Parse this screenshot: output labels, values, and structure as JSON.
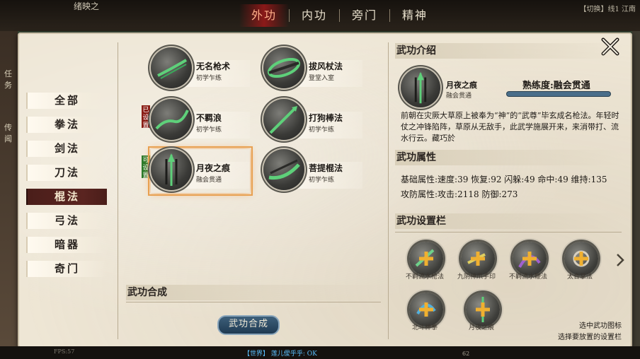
{
  "topbar": {
    "player_name": "绪映之",
    "tabs": [
      {
        "label": "外功",
        "active": true
      },
      {
        "label": "内功",
        "active": false
      },
      {
        "label": "旁门",
        "active": false
      },
      {
        "label": "精神",
        "active": false
      }
    ],
    "right_info": "【切换】线1   江南"
  },
  "left_side_text": [
    "任务",
    "传闻"
  ],
  "categories": [
    {
      "label": "全部",
      "active": false
    },
    {
      "label": "拳法",
      "active": false
    },
    {
      "label": "剑法",
      "active": false
    },
    {
      "label": "刀法",
      "active": false
    },
    {
      "label": "棍法",
      "active": true
    },
    {
      "label": "弓法",
      "active": false
    },
    {
      "label": "暗器",
      "active": false
    },
    {
      "label": "奇门",
      "active": false
    }
  ],
  "skills": [
    {
      "name": "无名枪术",
      "level": "初学乍练",
      "icon": "spear-green-icon",
      "tag": ""
    },
    {
      "name": "拔风杖法",
      "level": "登堂入室",
      "icon": "staff-wrap-icon",
      "tag": ""
    },
    {
      "name": "不羁浪",
      "level": "初学乍练",
      "icon": "spear-wave-icon",
      "tag": "已设置"
    },
    {
      "name": "打狗棒法",
      "level": "初学乍练",
      "icon": "stick-icon",
      "tag": ""
    },
    {
      "name": "月夜之痕",
      "level": "融会贯通",
      "icon": "spear-icon",
      "tag": "可设置"
    },
    {
      "name": "菩提棍法",
      "level": "初学乍练",
      "icon": "staff-curve-icon",
      "tag": ""
    }
  ],
  "synthesis": {
    "heading": "武功合成",
    "button_label": "武功合成"
  },
  "info": {
    "heading": "武功介绍",
    "skill_name": "月夜之痕",
    "skill_level": "融会贯通",
    "proficiency": "熟练度:融会贯通",
    "proficiency_progress": 1.0,
    "description": "前朝在灾厥大草原上被奉为“神”的“武尊”毕玄成名枪法。年轻时仗之冲锋陷阵，草原从无敌手，此武学施展开来，来消带打、流水行云。藏巧於",
    "attr_heading": "武功属性",
    "attr_line1": "基础属性:速度:39 恢复:92 闪躲:49 命中:49 维持:135",
    "attr_line2": "攻防属性:攻击:2118 防御:273",
    "slots_heading": "武功设置栏",
    "slots": [
      {
        "caption": "不羁流水枪法",
        "icon": "glove-plus-icon"
      },
      {
        "caption": "九阴神爪手印",
        "icon": "claw-plus-icon"
      },
      {
        "caption": "不羁流水鞭法",
        "icon": "whip-plus-icon"
      },
      {
        "caption": "太合掌法",
        "icon": "palm-plus-icon"
      },
      {
        "caption": "北斗神拳",
        "icon": "fist-plus-icon"
      },
      {
        "caption": "月夜之痕",
        "icon": "spear-plus-icon"
      }
    ],
    "hint_line1": "选中武功图标",
    "hint_line2": "选择要放置的设置栏"
  },
  "bottombar": {
    "fps": "FPS:57",
    "chat": "【世界】 莲儿僾乎乎: OK",
    "number": "62"
  },
  "colors": {
    "accent_red": "#8a1e16",
    "tab_active": "#ffb08a",
    "selected_border": "#e8a050",
    "button_blue": "#1f3a52"
  }
}
